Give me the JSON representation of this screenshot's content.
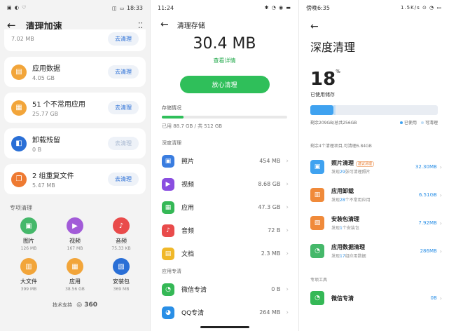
{
  "panel1": {
    "status_time": "18:33",
    "status_left": "▣ ◐ ♡",
    "status_right": "◫ ▭",
    "title": "清理加速",
    "partial_card": {
      "size": "7.02 MB",
      "button": "去清理"
    },
    "cards": [
      {
        "name": "应用数据",
        "size": "4.05 GB",
        "button": "去清理",
        "color": "#f2a53a",
        "icon": "▤",
        "dim": false
      },
      {
        "name": "51 个不常用应用",
        "size": "25.77 GB",
        "button": "去清理",
        "color": "#f2a53a",
        "icon": "▦",
        "dim": false
      },
      {
        "name": "卸载残留",
        "size": "0 B",
        "button": "去清理",
        "color": "#2a6fd6",
        "icon": "◧",
        "dim": true
      },
      {
        "name": "2 组重复文件",
        "size": "5.47 MB",
        "button": "去清理",
        "color": "#ee7a32",
        "icon": "❐",
        "dim": false
      }
    ],
    "section_title": "专项清理",
    "grid": [
      {
        "label": "图片",
        "size": "126 MB",
        "color": "#45b86a",
        "icon": "▣"
      },
      {
        "label": "视频",
        "size": "167 MB",
        "color": "#a25bd8",
        "icon": "▶"
      },
      {
        "label": "音频",
        "size": "75.33 KB",
        "color": "#e94b4b",
        "icon": "♪"
      },
      {
        "label": "大文件",
        "size": "399 MB",
        "color": "#f2a53a",
        "icon": "▥"
      },
      {
        "label": "应用",
        "size": "38.56 GB",
        "color": "#f2a53a",
        "icon": "▦"
      },
      {
        "label": "安装包",
        "size": "369 MB",
        "color": "#2a6fd6",
        "icon": "▧"
      }
    ],
    "footer": "技术支持",
    "footer_brand": "360"
  },
  "panel2": {
    "status_time": "11:24",
    "status_right": "✱ ◔ ◉ ▬",
    "title": "清理存储",
    "total_size": "30.4 MB",
    "detail_link": "查看详情",
    "main_button": "放心清理",
    "storage_label": "存储情况",
    "storage_fraction": 0.173,
    "storage_info": "已用 88.7 GB / 共 512 GB",
    "section_deep": "深度清理",
    "rows": [
      {
        "label": "照片",
        "value": "454 MB",
        "color": "#3a7de0",
        "icon": "▣"
      },
      {
        "label": "视频",
        "value": "8.68 GB",
        "color": "#8a4ee0",
        "icon": "▶"
      },
      {
        "label": "应用",
        "value": "47.3 GB",
        "color": "#35b856",
        "icon": "▦"
      },
      {
        "label": "音频",
        "value": "72 B",
        "color": "#e94b4b",
        "icon": "♪"
      },
      {
        "label": "文档",
        "value": "2.3 MB",
        "color": "#f0b829",
        "icon": "▤"
      }
    ],
    "section_app": "应用专清",
    "app_rows": [
      {
        "label": "微信专清",
        "value": "0 B",
        "color": "#35b856",
        "icon": "◔"
      },
      {
        "label": "QQ专清",
        "value": "264 MB",
        "color": "#2a8fe6",
        "icon": "◕"
      }
    ]
  },
  "panel3": {
    "status_left": "傍晚6:35",
    "status_right": "1.5K/s ⊙ ◔ ▭",
    "title": "深度清理",
    "percent": "18",
    "percent_sign": "%",
    "used_label": "已使用储存",
    "used_fraction": 0.18,
    "storage_text": "剩余209GB/总共256GB",
    "legend_used": "已使用",
    "legend_free": "可清理",
    "legend_used_color": "#3fa2f0",
    "legend_free_color": "#c2def6",
    "summary": "剩余4个清理项目,可清理6.84GB",
    "rows": [
      {
        "title": "照片清理",
        "tag": "建议清理",
        "desc_pre": "发现",
        "desc_num": "29",
        "desc_post": "张可清理照片",
        "value": "32.30MB",
        "color": "#3fa2f0",
        "icon": "▣"
      },
      {
        "title": "应用卸载",
        "tag": "",
        "desc_pre": "发现",
        "desc_num": "28",
        "desc_post": "个不常用应用",
        "value": "6.51GB",
        "color": "#f08a3a",
        "icon": "▥"
      },
      {
        "title": "安装包清理",
        "tag": "",
        "desc_pre": "发现",
        "desc_num": "1",
        "desc_post": "个安装包",
        "value": "7.92MB",
        "color": "#f08a3a",
        "icon": "▧"
      },
      {
        "title": "应用数据清理",
        "tag": "",
        "desc_pre": "发现",
        "desc_num": "17",
        "desc_post": "组应用数据",
        "value": "286MB",
        "color": "#45b86a",
        "icon": "◔"
      }
    ],
    "tools_title": "专项工具",
    "tool_rows": [
      {
        "title": "微信专清",
        "value": "0B",
        "color": "#35b856",
        "icon": "◔"
      }
    ]
  }
}
